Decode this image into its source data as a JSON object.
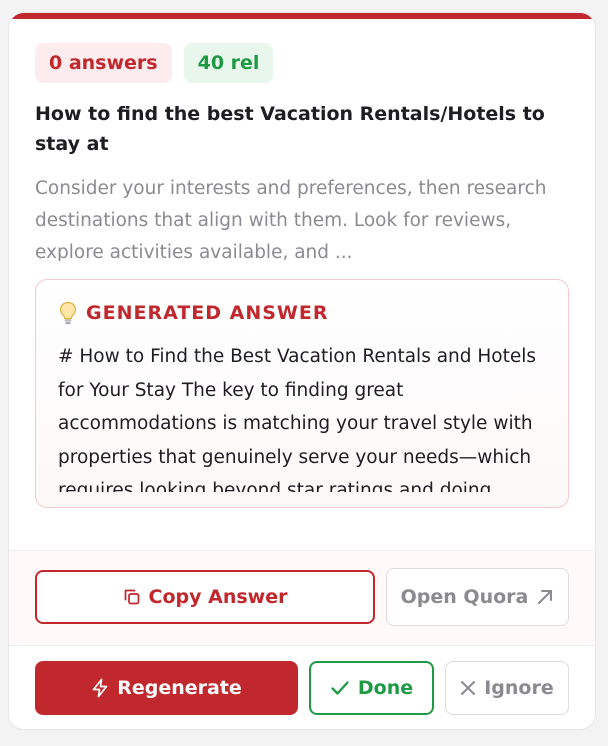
{
  "badges": {
    "answers": "0 answers",
    "rel": "40 rel"
  },
  "question": {
    "title": "How to find the best Vacation Rentals/Hotels to stay at",
    "description": "Consider your interests and preferences, then research destinations that align with them. Look for reviews, explore activities available, and ..."
  },
  "generated": {
    "label": "GENERATED ANSWER",
    "text": "# How to Find the Best Vacation Rentals and Hotels for Your Stay The key to finding great accommodations is matching your travel style with properties that genuinely serve your needs—which requires looking beyond star ratings and doing"
  },
  "actions": {
    "copy_label": "Copy Answer",
    "quora_label": "Open Quora",
    "regenerate_label": "Regenerate",
    "done_label": "Done",
    "ignore_label": "Ignore"
  },
  "colors": {
    "accent": "#c0282d",
    "success": "#1e9a45",
    "muted": "#8a8a90"
  },
  "icons": {
    "generated": "lightbulb-icon",
    "copy": "copy-icon",
    "quora": "arrow-up-right-icon",
    "regenerate": "lightning-icon",
    "done": "check-icon",
    "ignore": "x-icon"
  }
}
